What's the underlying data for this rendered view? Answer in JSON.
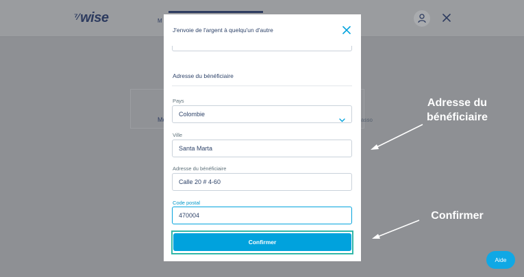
{
  "header": {
    "logo_text": "wise",
    "logo_mark": "⁷⁄",
    "tab_partial": "M",
    "tab_partial_right": "",
    "user_icon": "user-icon",
    "close_icon": "close-icon"
  },
  "background": {
    "card_partial_left": "Mo",
    "card_partial_right": "asso"
  },
  "modal": {
    "title": "J'envoie de l'argent à quelqu'un d'autre",
    "section_title": "Adresse du bénéficiaire",
    "fields": {
      "country": {
        "label": "Pays",
        "value": "Colombie"
      },
      "city": {
        "label": "Ville",
        "value": "Santa Marta"
      },
      "address": {
        "label": "Adresse du bénéficiaire",
        "value": "Calle 20 # 4-60"
      },
      "postal_code": {
        "label": "Code postal",
        "value": "470004"
      }
    },
    "confirm_label": "Confirmer"
  },
  "annotations": {
    "address_line1": "Adresse du",
    "address_line2": "bénéficiaire",
    "confirm": "Confirmer"
  },
  "help_label": "Aide",
  "colors": {
    "primary": "#00a2dd",
    "highlight_outline": "#2fb7a8",
    "text_dark": "#2e4369",
    "overlay": "#8e9094"
  }
}
